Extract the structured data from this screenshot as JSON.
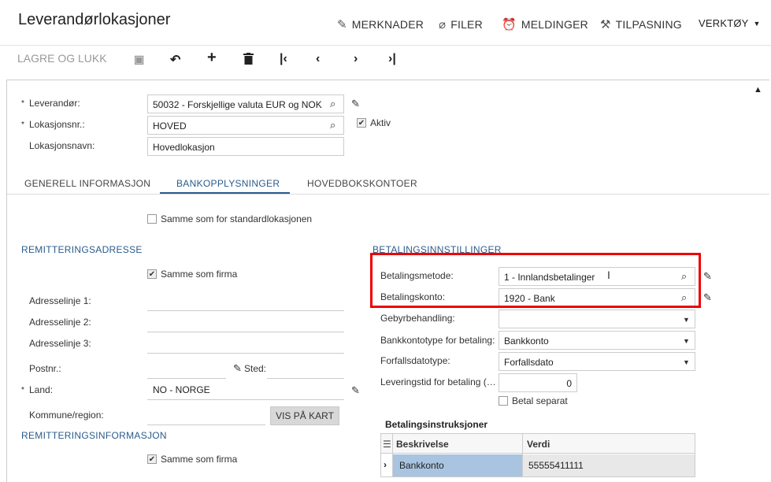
{
  "header": {
    "title": "Leverandørlokasjoner",
    "actions": {
      "notes": "MERKNADER",
      "files": "FILER",
      "notifications": "MELDINGER",
      "customization": "TILPASNING",
      "tools": "VERKTØY"
    }
  },
  "toolbar": {
    "save_close": "LAGRE OG LUKK"
  },
  "form": {
    "vendor_label": "Leverandør:",
    "vendor_value": "50032 - Forskjellige valuta EUR og NOK",
    "location_id_label": "Lokasjonsnr.:",
    "location_id_value": "HOVED",
    "active_label": "Aktiv",
    "location_name_label": "Lokasjonsnavn:",
    "location_name_value": "Hovedlokasjon",
    "required_mark": "*"
  },
  "tabs": [
    {
      "label": "GENERELL INFORMASJON"
    },
    {
      "label": "BANKOPPLYSNINGER"
    },
    {
      "label": "HOVEDBOKSKONTOER"
    }
  ],
  "bank": {
    "same_as_default": "Samme som for standardlokasjonen",
    "remit_address_title": "REMITTERINGSADRESSE",
    "same_as_company": "Samme som firma",
    "address1_label": "Adresselinje 1:",
    "address2_label": "Adresselinje 2:",
    "address3_label": "Adresselinje 3:",
    "postal_label": "Postnr.:",
    "city_label": "Sted:",
    "country_label": "Land:",
    "country_value": "NO - NORGE",
    "county_label": "Kommune/region:",
    "view_map": "VIS PÅ KART",
    "remit_info_title": "REMITTERINGSINFORMASJON",
    "same_as_company2": "Samme som firma"
  },
  "payment": {
    "title": "BETALINGSINNSTILLINGER",
    "method_label": "Betalingsmetode:",
    "method_value": "1 - Innlandsbetalinger",
    "account_label": "Betalingskonto:",
    "account_value": "1920 - Bank",
    "fee_label": "Gebyrbehandling:",
    "fee_value": "",
    "bank_account_type_label": "Bankkontotype for betaling:",
    "bank_account_type_value": "Bankkonto",
    "due_date_type_label": "Forfallsdatotype:",
    "due_date_type_value": "Forfallsdato",
    "lead_time_label": "Leveringstid for betaling (…",
    "lead_time_value": "0",
    "separate_label": "Betal separat"
  },
  "instructions": {
    "title": "Betalingsinstruksjoner",
    "columns": [
      "Beskrivelse",
      "Verdi"
    ],
    "rows": [
      {
        "description": "Bankkonto",
        "value": "55555411111"
      }
    ]
  }
}
